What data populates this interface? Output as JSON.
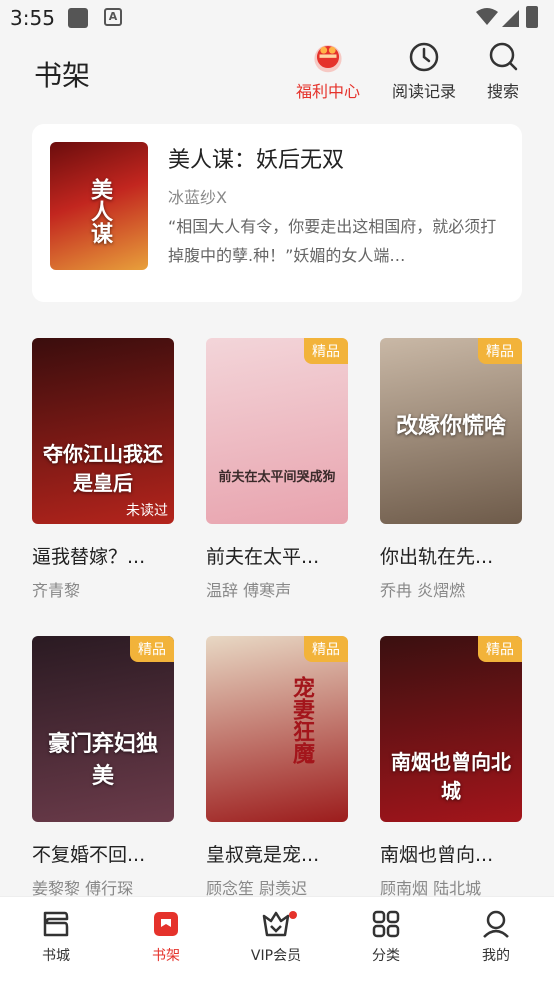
{
  "status": {
    "time": "3:55"
  },
  "header": {
    "title": "书架",
    "welfare_label": "福利中心",
    "history_label": "阅读记录",
    "search_label": "搜索"
  },
  "featured": {
    "title": "美人谋：妖后无双",
    "author": "冰蓝纱X",
    "description": "“相国大人有令，你要走出这相国府，就必须打掉腹中的孽.种！”妖媚的女人端…",
    "cover_text": "美人谋"
  },
  "books": [
    {
      "title": "逼我替嫁？...",
      "author": "齐青黎",
      "badge": "",
      "unread": "未读过",
      "cover_text": "夺你江山我还是皇后",
      "colors": [
        "#3a0d0d",
        "#b4241c"
      ]
    },
    {
      "title": "前夫在太平...",
      "author": "温辞   傅寒声",
      "badge": "精品",
      "unread": "",
      "cover_text": "前夫在太平间哭成狗",
      "colors": [
        "#f3d5d9",
        "#e8a3ae"
      ]
    },
    {
      "title": "你出轨在先...",
      "author": "乔冉   炎熠燃",
      "badge": "精品",
      "unread": "",
      "cover_text": "改嫁你慌啥",
      "colors": [
        "#c9b8a6",
        "#6e5b4a"
      ]
    },
    {
      "title": "不复婚不回...",
      "author": "姜黎黎   傅行琛",
      "badge": "精品",
      "unread": "",
      "cover_text": "豪门弃妇独美",
      "colors": [
        "#2a1a22",
        "#6b3b4a"
      ]
    },
    {
      "title": "皇叔竟是宠...",
      "author": "顾念笙   尉羡迟",
      "badge": "精品",
      "unread": "",
      "cover_text": "宠妻狂魔",
      "colors": [
        "#e8d8c4",
        "#9c1c1c"
      ]
    },
    {
      "title": "南烟也曾向...",
      "author": "顾南烟   陆北城",
      "badge": "精品",
      "unread": "",
      "cover_text": "南烟也曾向北城",
      "colors": [
        "#3a1010",
        "#a3151b"
      ]
    }
  ],
  "tabs": [
    "书城",
    "书架",
    "VIP会员",
    "分类",
    "我的"
  ],
  "accent_color": "#e5322b",
  "badge_color": "#f2b33a"
}
